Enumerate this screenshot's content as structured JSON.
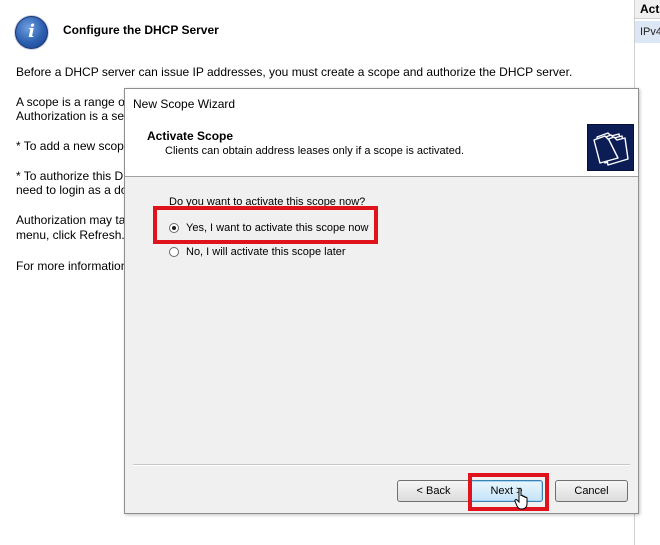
{
  "background_page": {
    "title": "Configure the DHCP Server",
    "lines": [
      "Before a DHCP server can issue IP addresses, you must create a scope and authorize the DHCP server.",
      "A scope is a range of",
      "Authorization is a sec",
      "* To add a new scope",
      "* To authorize this DI",
      "need to login as a do",
      "Authorization may ta",
      "menu, click Refresh.",
      "For more information"
    ]
  },
  "right_pane": {
    "header": "Act",
    "row": "IPv4"
  },
  "wizard": {
    "window_title": "New Scope Wizard",
    "header_title": "Activate Scope",
    "header_subtitle": "Clients can obtain address leases only if a scope is activated.",
    "header_icon": "folder-stack-icon",
    "question": "Do you want to activate this scope now?",
    "options": [
      {
        "label": "Yes, I want to activate this scope now",
        "checked": true
      },
      {
        "label": "No, I will activate this scope later",
        "checked": false
      }
    ],
    "buttons": {
      "back": "< Back",
      "next": "Next >",
      "cancel": "Cancel"
    }
  },
  "annotation_color": "#e0121c"
}
